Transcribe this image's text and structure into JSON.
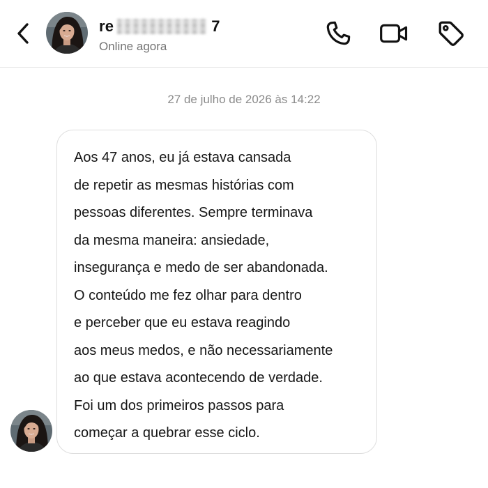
{
  "header": {
    "username_prefix": "re",
    "username_suffix": "7",
    "status": "Online agora",
    "icons": {
      "back": "chevron-left-icon",
      "call": "phone-icon",
      "video": "video-camera-icon",
      "tag": "tag-icon"
    }
  },
  "conversation": {
    "timestamp": "27 de julho de 2026 às 14:22",
    "message_lines": [
      "Aos 47 anos, eu já estava cansada",
      "de repetir as mesmas histórias com",
      "pessoas diferentes. Sempre terminava",
      "da mesma maneira: ansiedade,",
      "insegurança e medo de ser abandonada.",
      "O conteúdo me fez olhar para dentro",
      "e perceber que eu estava reagindo",
      "aos meus medos, e não necessariamente",
      "ao que estava acontecendo de verdade.",
      "Foi um dos primeiros passos para",
      "começar a quebrar esse ciclo."
    ]
  },
  "colors": {
    "text": "#111111",
    "secondary_text": "#737373",
    "timestamp_text": "#8a8a8a",
    "bubble_border": "#dedede",
    "divider": "#e6e6e6"
  }
}
